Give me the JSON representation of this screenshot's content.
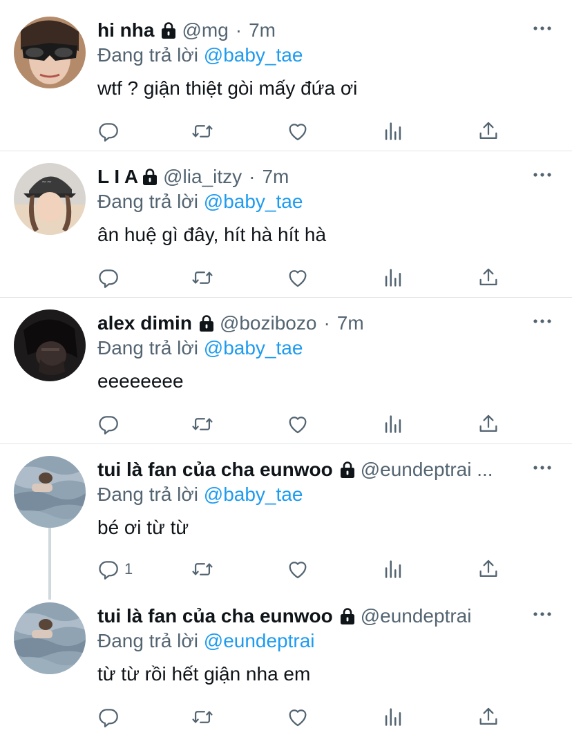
{
  "colors": {
    "accent": "#1d9bf0",
    "secondary_text": "#536471",
    "divider": "#e1e5e8"
  },
  "tweets": [
    {
      "name": "hi nha",
      "handle": "@mg",
      "dot": "·",
      "time": "7m",
      "replying_label": "Đang trả lời",
      "replying_to": "@baby_tae",
      "text": "wtf ? giận thiệt gòi mấy đứa ơi",
      "reply_count": ""
    },
    {
      "name": "L I A",
      "handle": "@lia_itzy",
      "dot": "·",
      "time": "7m",
      "replying_label": "Đang trả lời",
      "replying_to": "@baby_tae",
      "text": "ân huệ gì đây, hít hà hít hà",
      "reply_count": ""
    },
    {
      "name": "alex dimin",
      "handle": "@bozibozo",
      "dot": "·",
      "time": "7m",
      "replying_label": "Đang trả lời",
      "replying_to": "@baby_tae",
      "text": "eeeeeeee",
      "reply_count": ""
    },
    {
      "name": "tui là fan của cha eunwoo",
      "handle": "@eundeptrai ...",
      "dot": "",
      "time": "",
      "replying_label": "Đang trả lời",
      "replying_to": "@baby_tae",
      "text": "bé ơi từ từ",
      "reply_count": "1"
    },
    {
      "name": "tui là fan của cha eunwoo",
      "handle": "@eundeptrai",
      "dot": "",
      "time": "",
      "replying_label": "Đang trả lời",
      "replying_to": "@eundeptrai",
      "text": "từ từ rồi hết giận nha em",
      "reply_count": ""
    }
  ],
  "icons": {
    "reply": "reply-icon",
    "retweet": "retweet-icon",
    "like": "heart-icon",
    "analytics": "analytics-icon",
    "share": "share-icon",
    "more": "more-icon",
    "lock": "lock-icon"
  }
}
